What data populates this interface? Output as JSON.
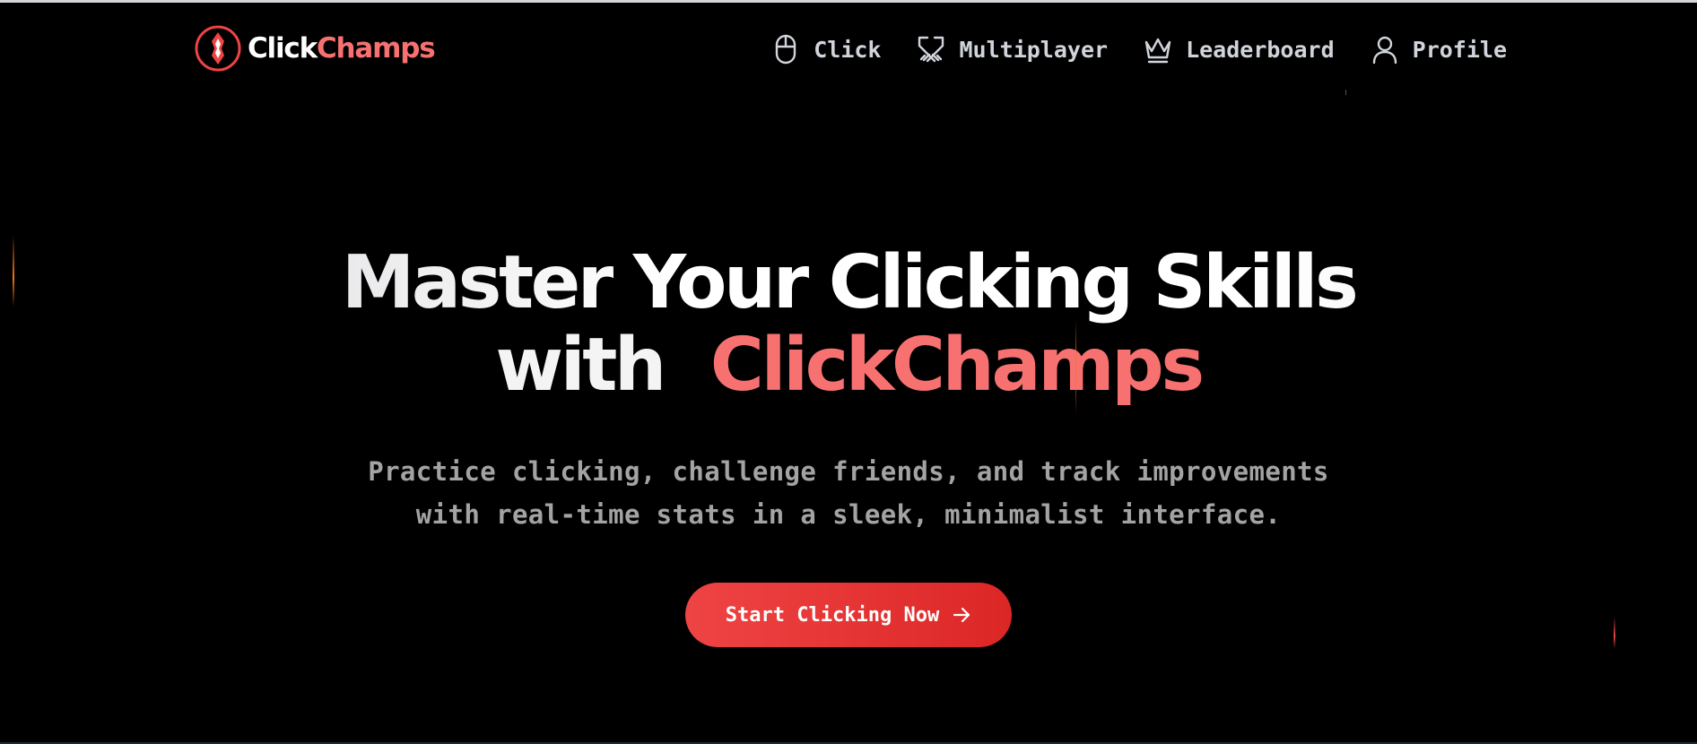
{
  "brand": {
    "name_part_a": "Click",
    "name_part_b": "Champs",
    "logo_icon": "shield-badge-icon",
    "accent_color": "#f87171",
    "primary_color": "#ef4444"
  },
  "nav": {
    "items": [
      {
        "label": "Click",
        "icon": "mouse-icon"
      },
      {
        "label": "Multiplayer",
        "icon": "crossed-swords-icon"
      },
      {
        "label": "Leaderboard",
        "icon": "crown-icon"
      },
      {
        "label": "Profile",
        "icon": "user-icon"
      }
    ]
  },
  "hero": {
    "headline_line1": "Master Your Clicking Skills",
    "headline_with": "with",
    "headline_brand": "ClickChamps",
    "subtitle_line1": "Practice clicking, challenge friends, and track improvements",
    "subtitle_line2": "with real-time stats in a sleek, minimalist interface.",
    "cta_label": "Start Clicking Now",
    "cta_icon": "arrow-right-icon"
  }
}
